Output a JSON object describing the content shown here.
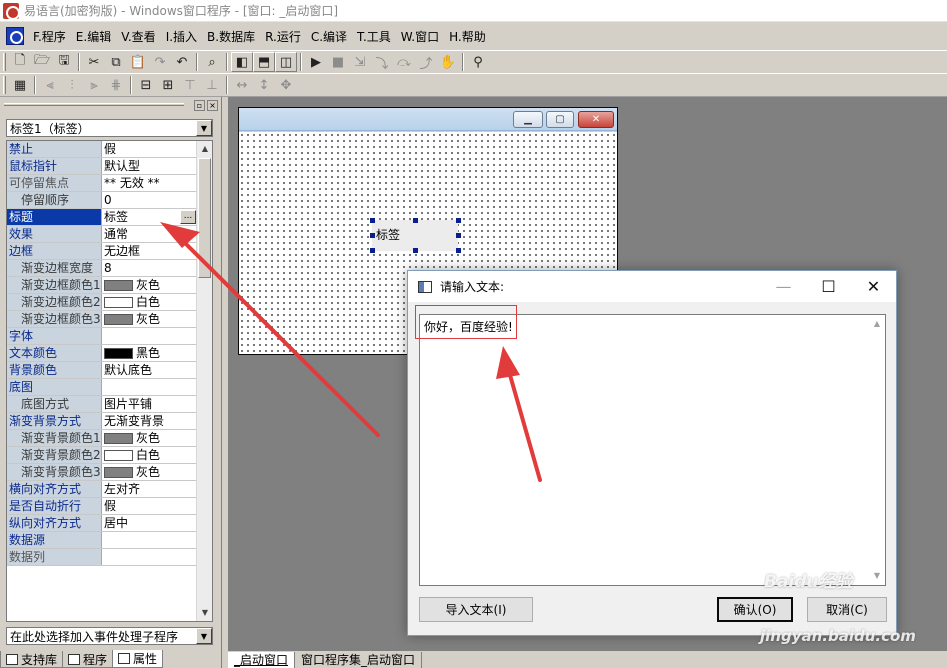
{
  "window": {
    "title": "易语言(加密狗版) - Windows窗口程序 - [窗口: _启动窗口]"
  },
  "menu": {
    "items": [
      "F.程序",
      "E.编辑",
      "V.查看",
      "I.插入",
      "B.数据库",
      "R.运行",
      "C.编译",
      "T.工具",
      "W.窗口",
      "H.帮助"
    ]
  },
  "toolbar1": {
    "buttons": [
      "new-icon",
      "open-icon",
      "save-icon",
      "cut-icon",
      "copy-icon",
      "paste-icon",
      "redo-icon",
      "undo-icon",
      "preview-icon",
      "layout-left-icon",
      "layout-top-icon",
      "layout-split-icon",
      "run-icon",
      "stop-icon",
      "step-icon",
      "step-into-icon",
      "step-over-icon",
      "step-out-icon",
      "hand-icon",
      "search-binoculars-icon"
    ]
  },
  "toolbar2": {
    "buttons": [
      "form-icon",
      "align-left-icon",
      "align-center-icon",
      "align-right-icon",
      "align-vcenter-icon",
      "center-h-icon",
      "center-v-icon",
      "align-top-icon",
      "align-middle-icon",
      "same-width-icon",
      "same-height-icon",
      "same-size-icon"
    ]
  },
  "properties": {
    "object_selector": "标签1（标签）",
    "rows": [
      {
        "name": "禁止",
        "value": "假"
      },
      {
        "name": "鼠标指针",
        "value": "默认型"
      },
      {
        "name": "可停留焦点",
        "value": "** 无效 **"
      },
      {
        "name": "停留顺序",
        "value": "0"
      },
      {
        "name": "标题",
        "value": "标签"
      },
      {
        "name": "效果",
        "value": "通常"
      },
      {
        "name": "边框",
        "value": "无边框"
      },
      {
        "name": "渐变边框宽度",
        "value": "8"
      },
      {
        "name": "渐变边框颜色1",
        "value": "灰色",
        "color": "#808080"
      },
      {
        "name": "渐变边框颜色2",
        "value": "白色",
        "color": "#ffffff"
      },
      {
        "name": "渐变边框颜色3",
        "value": "灰色",
        "color": "#808080"
      },
      {
        "name": "字体",
        "value": ""
      },
      {
        "name": "文本颜色",
        "value": "黑色",
        "color": "#000000"
      },
      {
        "name": "背景颜色",
        "value": "默认底色"
      },
      {
        "name": "底图",
        "value": ""
      },
      {
        "name": "底图方式",
        "value": "图片平铺"
      },
      {
        "name": "渐变背景方式",
        "value": "无渐变背景"
      },
      {
        "name": "渐变背景颜色1",
        "value": "灰色",
        "color": "#808080"
      },
      {
        "name": "渐变背景颜色2",
        "value": "白色",
        "color": "#ffffff"
      },
      {
        "name": "渐变背景颜色3",
        "value": "灰色",
        "color": "#808080"
      },
      {
        "name": "横向对齐方式",
        "value": "左对齐"
      },
      {
        "name": "是否自动折行",
        "value": "假"
      },
      {
        "name": "纵向对齐方式",
        "value": "居中"
      },
      {
        "name": "数据源",
        "value": ""
      },
      {
        "name": "数据列",
        "value": ""
      }
    ],
    "ellipsis_label": "...",
    "event_selector": "在此处选择加入事件处理子程序"
  },
  "panel_tabs": {
    "support": "支持库",
    "program": "程序",
    "properties": "属性"
  },
  "form": {
    "label_text": "标签"
  },
  "doc_tabs": {
    "items": [
      "_启动窗口",
      "窗口程序集_启动窗口"
    ]
  },
  "dialog": {
    "title": "请输入文本:",
    "text": "你好，百度经验!",
    "import_button": "导入文本(I)",
    "ok_button": "确认(O)",
    "cancel_button": "取消(C)"
  },
  "watermark": {
    "line1": "Baidu经验",
    "line2": "jingyan.baidu.com"
  },
  "colors": {
    "selected_row": "#0a3aa8",
    "annotation_red": "#e23b3b"
  }
}
